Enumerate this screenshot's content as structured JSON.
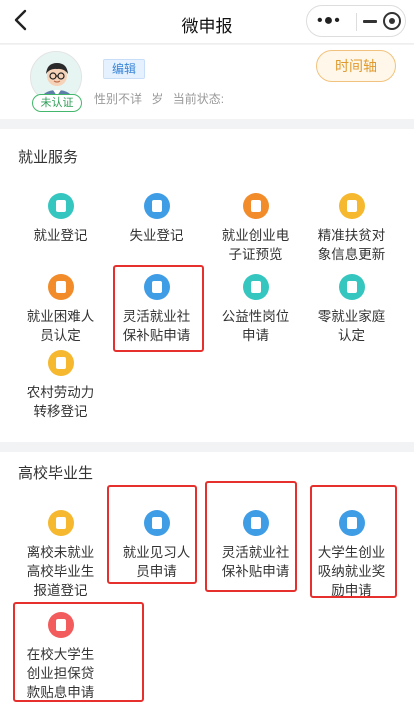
{
  "header": {
    "title": "微申报"
  },
  "profile": {
    "status": "未认证",
    "edit_label": "编辑",
    "gender_label": "性别不详",
    "age_unit": "岁",
    "status_label": "当前状态:",
    "timeline_label": "时间轴"
  },
  "sections": [
    {
      "title": "就业服务",
      "items": [
        {
          "lines": [
            "就业登记"
          ],
          "color": "#36c6c0",
          "icon": "document-icon"
        },
        {
          "lines": [
            "失业登记"
          ],
          "color": "#3f9de6",
          "icon": "document-icon"
        },
        {
          "lines": [
            "就业创业电",
            "子证预览"
          ],
          "color": "#f28c2a",
          "icon": "id-card-icon"
        },
        {
          "lines": [
            "精准扶贫对",
            "象信息更新"
          ],
          "color": "#f5b82e",
          "icon": "clipboard-icon"
        },
        {
          "lines": [
            "就业困难人",
            "员认定"
          ],
          "color": "#f28c2a",
          "icon": "person-icon"
        },
        {
          "lines": [
            "灵活就业社",
            "保补贴申请"
          ],
          "color": "#3f9de6",
          "icon": "card-icon"
        },
        {
          "lines": [
            "公益性岗位",
            "申请"
          ],
          "color": "#36c6c0",
          "icon": "heart-icon"
        },
        {
          "lines": [
            "零就业家庭",
            "认定"
          ],
          "color": "#36c6c0",
          "icon": "person-icon"
        },
        {
          "lines": [
            "农村劳动力",
            "转移登记"
          ],
          "color": "#f5b82e",
          "icon": "person-icon"
        }
      ]
    },
    {
      "title": "高校毕业生",
      "items": [
        {
          "lines": [
            "离校未就业",
            "高校毕业生",
            "报道登记"
          ],
          "color": "#f5b82e",
          "icon": "list-icon"
        },
        {
          "lines": [
            "就业见习人",
            "员申请"
          ],
          "color": "#3f9de6",
          "icon": "edit-icon"
        },
        {
          "lines": [
            "灵活就业社",
            "保补贴申请"
          ],
          "color": "#3f9de6",
          "icon": "edit-icon"
        },
        {
          "lines": [
            "大学生创业",
            "吸纳就业奖",
            "励申请"
          ],
          "color": "#3f9de6",
          "icon": "card-icon"
        },
        {
          "lines": [
            "在校大学生",
            "创业担保贷",
            "款贴息申请"
          ],
          "color": "#f25c5c",
          "icon": "wallet-icon"
        }
      ]
    }
  ]
}
